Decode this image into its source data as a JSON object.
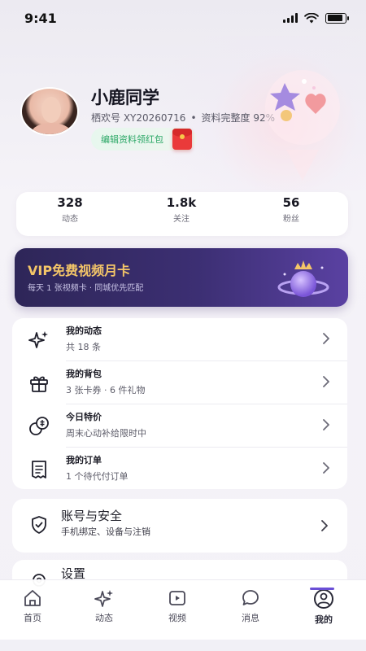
{
  "status_bar": {
    "time": "9:41",
    "battery_level": 0.9
  },
  "profile": {
    "name": "小鹿同学",
    "id_label": "栖欢号 XY20260716",
    "separator": "•",
    "completeness": "资料完整度 92%",
    "edit_chip": "编辑资料领红包"
  },
  "stats": [
    {
      "value": "328",
      "label": "动态"
    },
    {
      "value": "1.8k",
      "label": "关注"
    },
    {
      "value": "56",
      "label": "粉丝"
    }
  ],
  "vip": {
    "title": "VIP免费视频月卡",
    "subtitle": "每天 1 张视频卡 · 同城优先匹配"
  },
  "menu": [
    {
      "title": "我的动态",
      "subtitle": "共 18 条",
      "icon": "sparkle-icon"
    },
    {
      "title": "我的背包",
      "subtitle": "3 张卡券 · 6 件礼物",
      "icon": "gift-icon"
    },
    {
      "title": "今日特价",
      "subtitle": "周末心动补给限时中",
      "icon": "coins-icon"
    },
    {
      "title": "我的订单",
      "subtitle": "1 个待代付订单",
      "icon": "receipt-icon"
    }
  ],
  "account": {
    "title": "账号与安全",
    "subtitle": "手机绑定、设备与注销",
    "icon": "shield-icon"
  },
  "settings": {
    "title": "设置",
    "icon": "gear-icon"
  },
  "tabs": [
    {
      "label": "首页",
      "icon": "home-icon"
    },
    {
      "label": "动态",
      "icon": "sparkle-icon"
    },
    {
      "label": "视频",
      "icon": "video-icon"
    },
    {
      "label": "消息",
      "icon": "chat-icon"
    },
    {
      "label": "我的",
      "icon": "user-icon",
      "active": true
    }
  ],
  "colors": {
    "accent": "#6a4fd6",
    "vip_gold": "#f4c668",
    "chip_green": "#2aa765",
    "red_packet": "#ea3a3a"
  }
}
